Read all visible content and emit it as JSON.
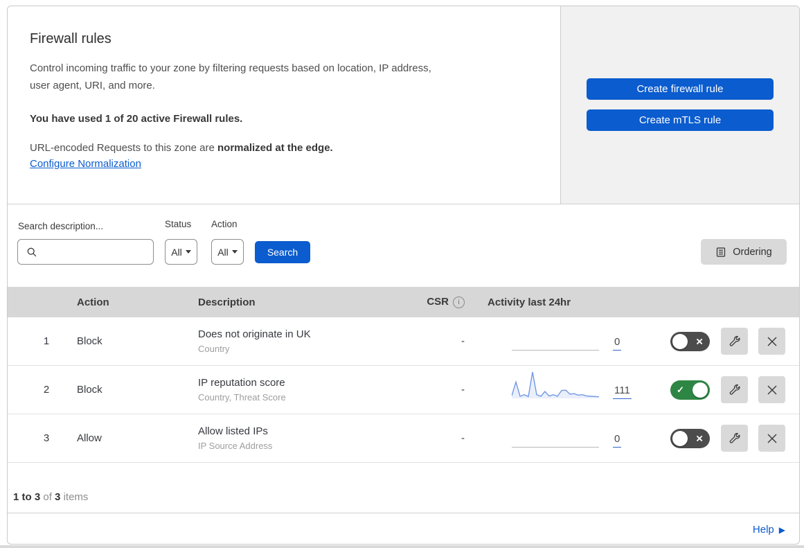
{
  "header": {
    "title": "Firewall rules",
    "description_line1": "Control incoming traffic to your zone by filtering requests based on location, IP address,",
    "description_line2": "user agent, URI, and more.",
    "usage_text": "You have used 1 of 20 active Firewall rules.",
    "normalization_text": "URL-encoded Requests to this zone are",
    "normalization_bold": "normalized at the edge.",
    "normalization_link": "Configure Normalization",
    "create_firewall_button": "Create firewall rule",
    "create_mtls_button": "Create mTLS rule"
  },
  "filters": {
    "search_label": "Search description...",
    "status_label": "Status",
    "status_value": "All",
    "action_label": "Action",
    "action_value": "All",
    "search_button": "Search",
    "ordering_button": "Ordering"
  },
  "table": {
    "headers": {
      "action": "Action",
      "description": "Description",
      "csr": "CSR",
      "activity": "Activity last 24hr"
    },
    "rows": [
      {
        "priority": "1",
        "action": "Block",
        "description": "Does not originate in UK",
        "criteria": "Country",
        "csr": "-",
        "activity_count": "0",
        "enabled": false,
        "sparkline": []
      },
      {
        "priority": "2",
        "action": "Block",
        "description": "IP reputation score",
        "criteria": "Country, Threat Score",
        "csr": "-",
        "activity_count": "111",
        "enabled": true,
        "sparkline": [
          10,
          62,
          8,
          14,
          7,
          100,
          14,
          8,
          26,
          9,
          14,
          8,
          30,
          31,
          16,
          18,
          12,
          14,
          9,
          8,
          7,
          6
        ]
      },
      {
        "priority": "3",
        "action": "Allow",
        "description": "Allow listed IPs",
        "criteria": "IP Source Address",
        "csr": "-",
        "activity_count": "0",
        "enabled": false,
        "sparkline": []
      }
    ]
  },
  "footer": {
    "range": "1 to 3",
    "of": "of",
    "total": "3",
    "items": "items",
    "help": "Help"
  },
  "icons": {
    "toggle_check": "✓",
    "toggle_x": "×",
    "info": "i",
    "help_arrow": "▶"
  },
  "colors": {
    "accent_blue": "#0b5cce",
    "toggle_on_green": "#2e8644",
    "toggle_off_grey": "#4c4c4c",
    "sparkline_stroke": "#7298e3",
    "sparkline_fill": "#e9effb",
    "panel_grey": "#f1f1f1",
    "table_header_grey": "#d7d7d7"
  }
}
